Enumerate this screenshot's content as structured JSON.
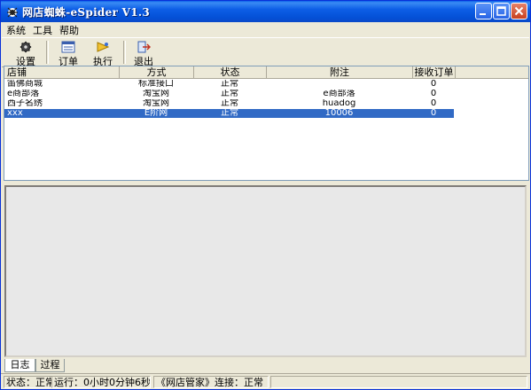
{
  "window": {
    "title": "网店蜘蛛-eSpider V1.3"
  },
  "menu": [
    "系统",
    "工具",
    "帮助"
  ],
  "toolbar": {
    "settings_label": "设置",
    "orders_label": "订单",
    "execute_label": "执行",
    "exit_label": "退出"
  },
  "table": {
    "columns": [
      "店铺",
      "方式",
      "状态",
      "附注",
      "接收订单"
    ],
    "rows": [
      [
        "笛佛商城",
        "标准接口",
        "正常",
        "",
        "0"
      ],
      [
        "e商部落",
        "淘宝网",
        "正常",
        "e商部落",
        "0"
      ],
      [
        "西子名绣",
        "淘宝网",
        "正常",
        "huadog",
        "0"
      ],
      [
        "xxx",
        "E阶网",
        "正常",
        "10006",
        "0"
      ]
    ],
    "selected_row": 3
  },
  "tabs": [
    "日志",
    "过程"
  ],
  "status": {
    "state": "状态：正常",
    "runtime": "运行：0小时0分钟6秒",
    "connection": "《网店管家》连接：正常"
  },
  "colors": {
    "titlebar": "#0a5fe8",
    "selection": "#316ac5",
    "face": "#ece9d8"
  }
}
